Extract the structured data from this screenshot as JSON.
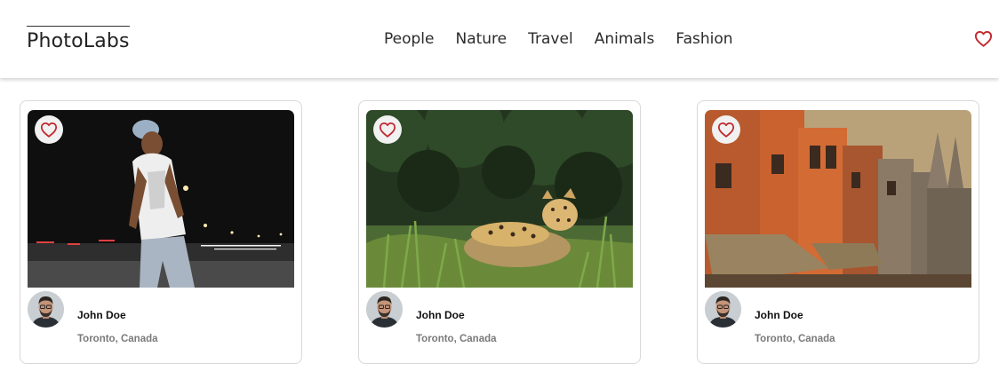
{
  "app": {
    "logo": "PhotoLabs"
  },
  "nav": {
    "topics": [
      "People",
      "Nature",
      "Travel",
      "Animals",
      "Fashion"
    ]
  },
  "header": {
    "favourites_icon": "heart-outline-icon"
  },
  "colors": {
    "heart": "#c0292f",
    "location_text": "#7a7a7a"
  },
  "photos": [
    {
      "subject": "street-portrait-night",
      "user": {
        "name": "John Doe",
        "location": "Toronto, Canada"
      },
      "favourite_icon": "heart-outline-icon"
    },
    {
      "subject": "jaguar-in-grass",
      "user": {
        "name": "John Doe",
        "location": "Toronto, Canada"
      },
      "favourite_icon": "heart-outline-icon"
    },
    {
      "subject": "riverside-old-buildings",
      "user": {
        "name": "John Doe",
        "location": "Toronto, Canada"
      },
      "favourite_icon": "heart-outline-icon"
    }
  ]
}
